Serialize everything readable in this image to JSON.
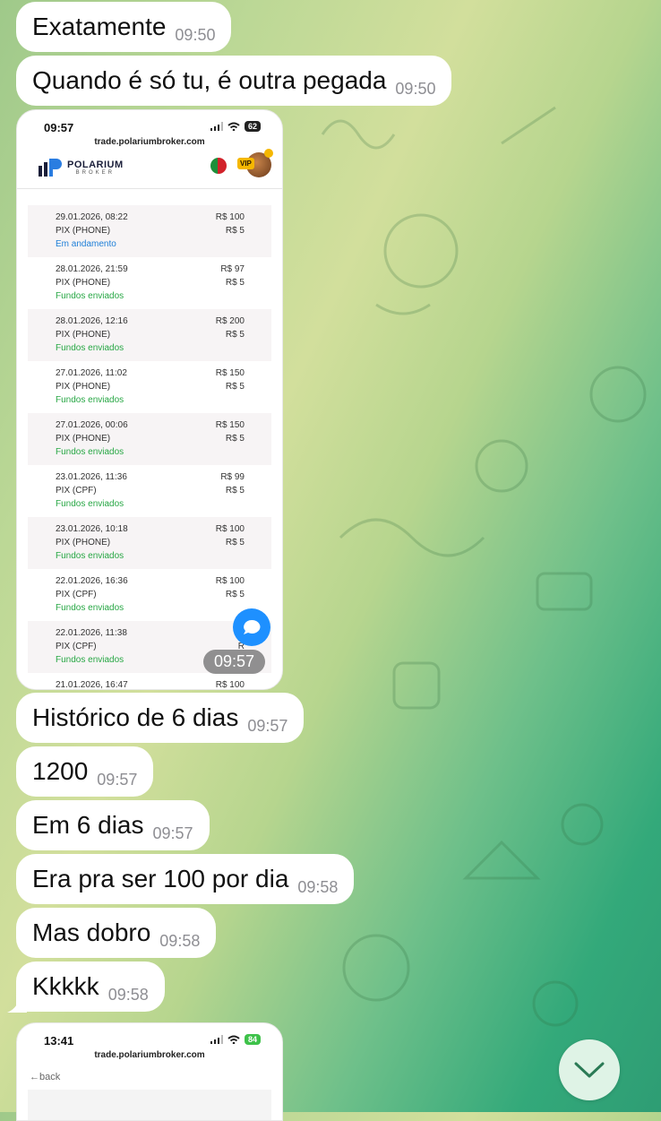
{
  "messages_top": [
    {
      "text": "Exatamente",
      "time": "09:50"
    },
    {
      "text": "Quando é só tu, é outra pegada",
      "time": "09:50"
    }
  ],
  "screenshot1": {
    "status_time": "09:57",
    "battery": "62",
    "url": "trade.polariumbroker.com",
    "brand_name": "POLARIUM",
    "brand_sub": "BROKER",
    "vip_label": "VIP",
    "message_time": "09:57",
    "transactions": [
      {
        "date": "29.01.2026, 08:22",
        "method": "PIX (PHONE)",
        "status": "Em andamento",
        "amount": "R$ 100",
        "fee": "R$ 5"
      },
      {
        "date": "28.01.2026, 21:59",
        "method": "PIX (PHONE)",
        "status": "Fundos enviados",
        "amount": "R$ 97",
        "fee": "R$ 5"
      },
      {
        "date": "28.01.2026, 12:16",
        "method": "PIX (PHONE)",
        "status": "Fundos enviados",
        "amount": "R$ 200",
        "fee": "R$ 5"
      },
      {
        "date": "27.01.2026, 11:02",
        "method": "PIX (PHONE)",
        "status": "Fundos enviados",
        "amount": "R$ 150",
        "fee": "R$ 5"
      },
      {
        "date": "27.01.2026, 00:06",
        "method": "PIX (PHONE)",
        "status": "Fundos enviados",
        "amount": "R$ 150",
        "fee": "R$ 5"
      },
      {
        "date": "23.01.2026, 11:36",
        "method": "PIX (CPF)",
        "status": "Fundos enviados",
        "amount": "R$ 99",
        "fee": "R$ 5"
      },
      {
        "date": "23.01.2026, 10:18",
        "method": "PIX (PHONE)",
        "status": "Fundos enviados",
        "amount": "R$ 100",
        "fee": "R$ 5"
      },
      {
        "date": "22.01.2026, 16:36",
        "method": "PIX (CPF)",
        "status": "Fundos enviados",
        "amount": "R$ 100",
        "fee": "R$ 5"
      },
      {
        "date": "22.01.2026, 11:38",
        "method": "PIX (CPF)",
        "status": "Fundos enviados",
        "amount": "R",
        "fee": "R"
      },
      {
        "date": "21.01.2026, 16:47",
        "method": "",
        "status": "",
        "amount": "R$ 100",
        "fee": ""
      }
    ]
  },
  "messages_bottom": [
    {
      "text": "Histórico de 6 dias",
      "time": "09:57"
    },
    {
      "text": "1200",
      "time": "09:57"
    },
    {
      "text": "Em 6 dias",
      "time": "09:57"
    },
    {
      "text": "Era pra ser 100 por dia",
      "time": "09:58"
    },
    {
      "text": "Mas dobro",
      "time": "09:58"
    },
    {
      "text": "Kkkkk",
      "time": "09:58"
    }
  ],
  "screenshot2": {
    "status_time": "13:41",
    "battery": "84",
    "url": "trade.polariumbroker.com",
    "back_label": "←back"
  },
  "icons": [
    "signal-icon",
    "wifi-icon",
    "battery-icon",
    "polarium-logo-icon",
    "flag-icon",
    "avatar-icon",
    "chat-icon",
    "chevron-down-icon"
  ],
  "colors": {
    "pending": "#1e7fd8",
    "sent": "#28a745",
    "chat_button": "#1e90ff"
  }
}
